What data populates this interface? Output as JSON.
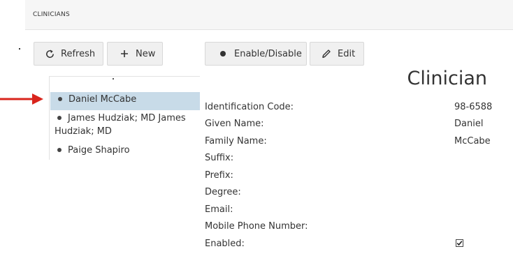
{
  "header": {
    "title": "CLINICIANS"
  },
  "toolbar": {
    "refresh_label": "Refresh",
    "new_label": "New",
    "enable_disable_label": "Enable/Disable",
    "edit_label": "Edit"
  },
  "tree": {
    "items": [
      {
        "label": "Daniel McCabe",
        "selected": true
      },
      {
        "label_line1": "James Hudziak; MD James",
        "label_line2": "Hudziak; MD"
      },
      {
        "label": "Paige Shapiro"
      }
    ]
  },
  "panel": {
    "title": "Clinician",
    "fields": [
      {
        "label": "Identification Code:",
        "value": "98-6588"
      },
      {
        "label": "Given Name:",
        "value": "Daniel"
      },
      {
        "label": "Family Name:",
        "value": "McCabe"
      },
      {
        "label": "Suffix:",
        "value": ""
      },
      {
        "label": "Prefix:",
        "value": ""
      },
      {
        "label": "Degree:",
        "value": ""
      },
      {
        "label": "Email:",
        "value": ""
      },
      {
        "label": "Mobile Phone Number:",
        "value": ""
      },
      {
        "label": "Enabled:",
        "checked": true
      }
    ]
  },
  "colors": {
    "selected_row": "#c8dbe8",
    "annotation_arrow": "#d9241c",
    "header_bg": "#f6f6f6"
  }
}
